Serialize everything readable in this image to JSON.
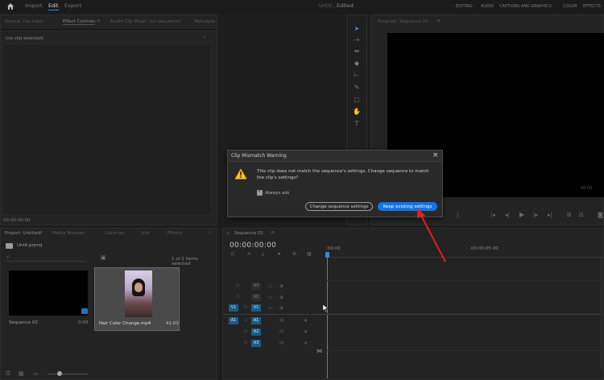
{
  "topbar": {
    "home_icon": "home-icon",
    "tabs": [
      "Import",
      "Edit",
      "Export"
    ],
    "doc_title": "Untit...",
    "doc_status": "Edited",
    "workspaces": [
      "EDITING",
      "AUDIO",
      "CAPTIONS AND GRAPHICS",
      "COLOR",
      "EFFECTS"
    ]
  },
  "source_panel": {
    "tabs": [
      "Source: (no clips)",
      "Effect Controls",
      "Audio Clip Mixer: (no sequence)",
      "Metadata"
    ],
    "active_tab": 1,
    "no_clip": "(no clip selected)",
    "timecode": "00:00:00:00"
  },
  "program_panel": {
    "title": "Program: Sequence 02",
    "bottom_text": "00:00"
  },
  "project_panel": {
    "tabs": [
      "Project: Untitled",
      "Media Browser",
      "Libraries",
      "Info",
      "Effects"
    ],
    "project_name": "Untit.prproj",
    "items_status": "1 of 2 items selected",
    "items": [
      {
        "name": "Sequence 02",
        "duration": "0:00"
      },
      {
        "name": "Hair Color Change.mp4",
        "duration": "41:01"
      }
    ]
  },
  "timeline_panel": {
    "title": "Sequence 02",
    "timecode": "00:00:00:00",
    "ruler_start": ":00:00",
    "ruler_mid": "00:00:05:00",
    "video_tracks": [
      "V3",
      "V2",
      "V1"
    ],
    "audio_tracks": [
      "A1",
      "A2",
      "A3"
    ],
    "source_patch_v": "V1",
    "source_patch_a": "A1"
  },
  "dialog": {
    "title": "Clip Mismatch Warning",
    "message": "This clip does not match the sequence's settings. Change sequence to match the clip's settings?",
    "checkbox_label": "Always ask",
    "checkbox_checked": true,
    "btn_change": "Change sequence settings",
    "btn_keep": "Keep existing settings",
    "close_label": "×"
  },
  "colors": {
    "accent": "#1473e6",
    "track_blue": "#1b5b87",
    "arrow": "#e02020",
    "warning": "#f5c518"
  }
}
